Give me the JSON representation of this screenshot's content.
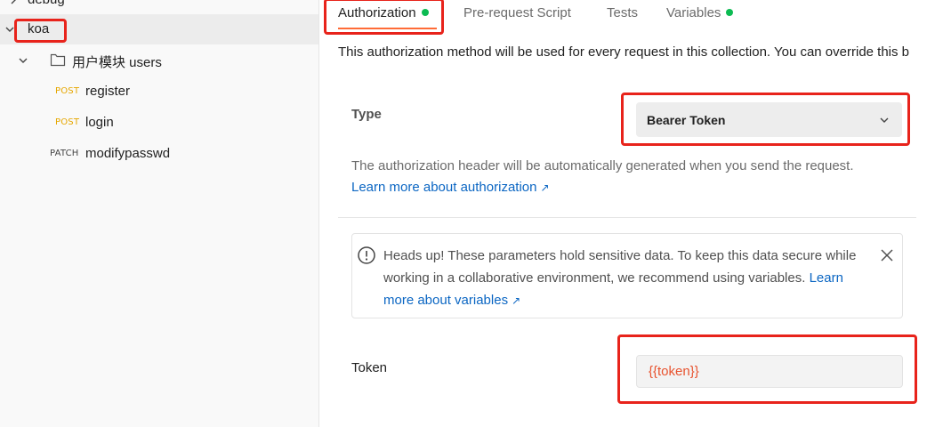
{
  "sidebar": {
    "cut_item": "debug",
    "collection": "koa",
    "folder": "用户模块 users",
    "requests": [
      {
        "method": "POST",
        "name": "register"
      },
      {
        "method": "POST",
        "name": "login"
      },
      {
        "method": "PATCH",
        "name": "modifypasswd"
      }
    ]
  },
  "tabs": [
    {
      "label": "Authorization",
      "has_dot": true,
      "active": true
    },
    {
      "label": "Pre-request Script",
      "has_dot": false,
      "active": false
    },
    {
      "label": "Tests",
      "has_dot": false,
      "active": false
    },
    {
      "label": "Variables",
      "has_dot": true,
      "active": false
    }
  ],
  "auth": {
    "description": "This authorization method will be used for every request in this collection. You can override this b",
    "type_label": "Type",
    "type_value": "Bearer Token",
    "help_text": "The authorization header will be automatically generated when you send the request.",
    "learn_more": "Learn more about authorization",
    "alert_text": "Heads up! These parameters hold sensitive data. To keep this data secure while working in a collaborative environment, we recommend using variables.",
    "alert_link": "Learn more about variables",
    "token_label": "Token",
    "token_value": "{{token}}"
  },
  "colors": {
    "accent": "#ff6c37",
    "status_dot": "#0cbb52",
    "link": "#0b66c3",
    "post_method": "#e6a700",
    "variable": "#e8532f",
    "annotation": "#e8231b"
  },
  "icons": [
    "chevron-right-icon",
    "chevron-down-icon",
    "folder-icon",
    "info-icon",
    "close-icon",
    "external-link-icon"
  ]
}
